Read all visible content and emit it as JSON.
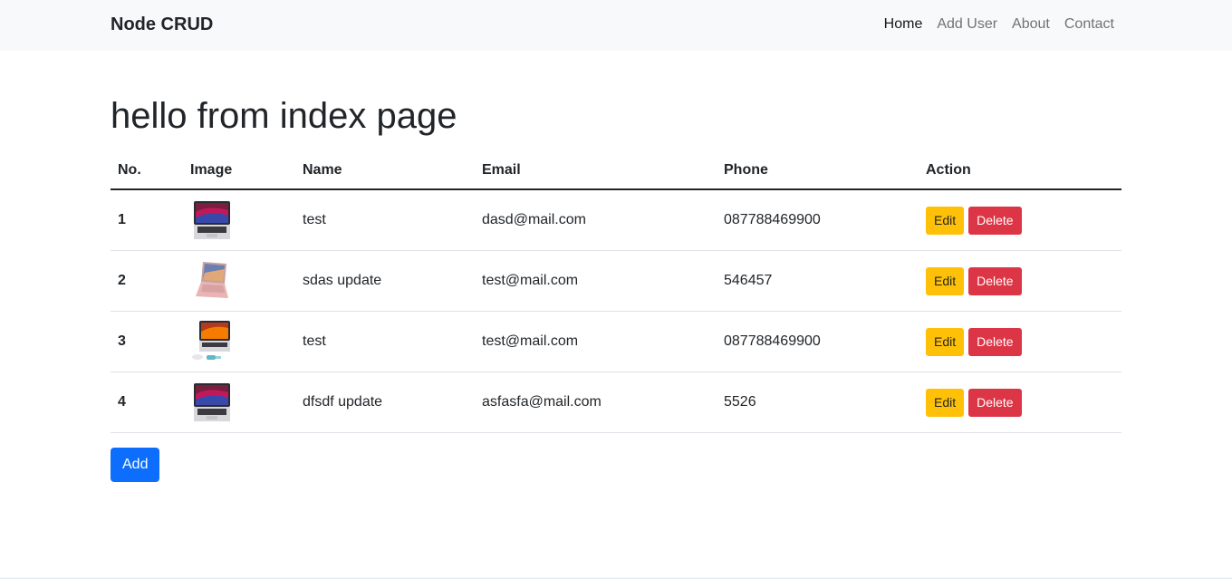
{
  "navbar": {
    "brand": "Node CRUD",
    "links": [
      {
        "label": "Home",
        "active": true
      },
      {
        "label": "Add User",
        "active": false
      },
      {
        "label": "About",
        "active": false
      },
      {
        "label": "Contact",
        "active": false
      }
    ]
  },
  "page": {
    "title": "hello from index page"
  },
  "table": {
    "headers": [
      "No.",
      "Image",
      "Name",
      "Email",
      "Phone",
      "Action"
    ],
    "rows": [
      {
        "no": "1",
        "image": "laptop-dark-icon",
        "name": "test",
        "email": "dasd@mail.com",
        "phone": "087788469900"
      },
      {
        "no": "2",
        "image": "laptop-pink-icon",
        "name": "sdas update",
        "email": "test@mail.com",
        "phone": "546457"
      },
      {
        "no": "3",
        "image": "laptop-mouse-icon",
        "name": "test",
        "email": "test@mail.com",
        "phone": "087788469900"
      },
      {
        "no": "4",
        "image": "laptop-dark-icon",
        "name": "dfsdf update",
        "email": "asfasfa@mail.com",
        "phone": "5526"
      }
    ],
    "edit_label": "Edit",
    "delete_label": "Delete"
  },
  "add_button": "Add",
  "colors": {
    "navbar_bg": "#f8f9fa",
    "edit": "#ffc107",
    "delete": "#dc3545",
    "primary": "#0d6efd"
  }
}
